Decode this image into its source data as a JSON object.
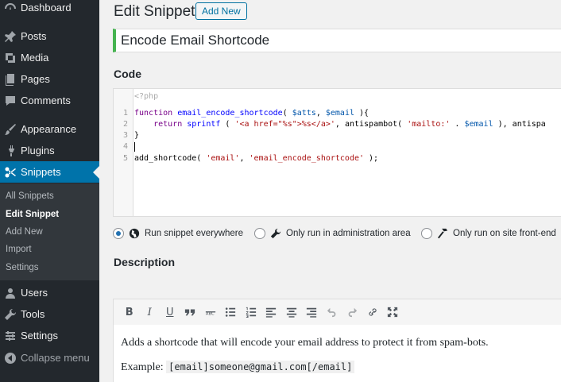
{
  "sidebar": {
    "items": [
      {
        "label": "Dashboard",
        "icon": "dashboard-icon"
      },
      {
        "label": "Posts",
        "icon": "pin-icon"
      },
      {
        "label": "Media",
        "icon": "media-icon"
      },
      {
        "label": "Pages",
        "icon": "pages-icon"
      },
      {
        "label": "Comments",
        "icon": "comment-icon"
      },
      {
        "label": "Appearance",
        "icon": "brush-icon"
      },
      {
        "label": "Plugins",
        "icon": "plug-icon"
      },
      {
        "label": "Snippets",
        "icon": "scissors-icon"
      },
      {
        "label": "Users",
        "icon": "user-icon"
      },
      {
        "label": "Tools",
        "icon": "wrench-icon"
      },
      {
        "label": "Settings",
        "icon": "settings-icon"
      },
      {
        "label": "Collapse menu",
        "icon": "collapse-icon"
      }
    ],
    "submenu": [
      "All Snippets",
      "Edit Snippet",
      "Add New",
      "Import",
      "Settings"
    ],
    "accent_color": "#0073aa"
  },
  "header": {
    "title": "Edit Snippet",
    "add_new_label": "Add New"
  },
  "snippet": {
    "title": "Encode Email Shortcode"
  },
  "code_section": {
    "heading": "Code",
    "php_open": "<?php",
    "line_numbers": [
      "1",
      "2",
      "3",
      "4",
      "5"
    ]
  },
  "scope": {
    "options": [
      {
        "label": "Run snippet everywhere",
        "icon": "globe-icon",
        "checked": true
      },
      {
        "label": "Only run in administration area",
        "icon": "wrench-icon",
        "checked": false
      },
      {
        "label": "Only run on site front-end",
        "icon": "hammer-icon",
        "checked": false
      }
    ]
  },
  "description": {
    "heading": "Description",
    "line1": "Adds a shortcode that will encode your email address to protect it from spam-bots.",
    "example_label": "Example:",
    "example_code": "[email]someone@gmail.com[/email]"
  }
}
